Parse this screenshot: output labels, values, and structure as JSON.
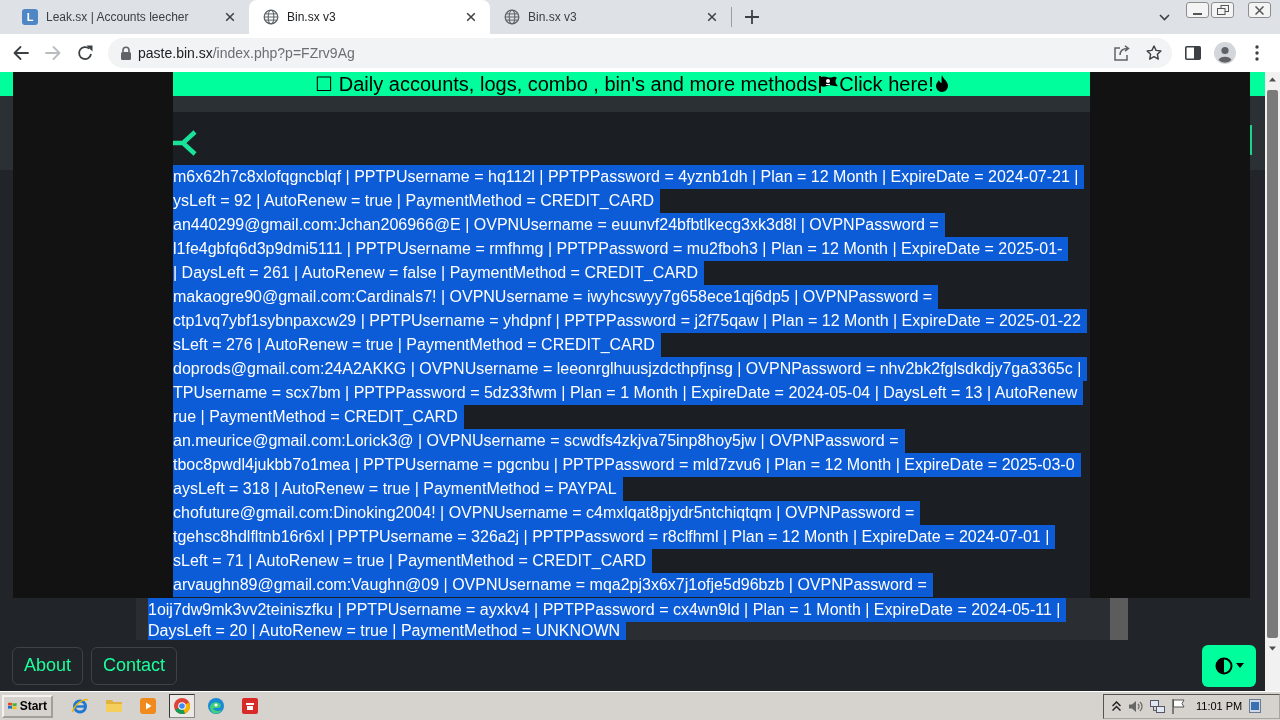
{
  "browser": {
    "tabs": [
      {
        "title": "Leak.sx | Accounts leecher",
        "kind": "letter",
        "favicon_text": "L",
        "selected": false
      },
      {
        "title": "Bin.sx v3",
        "kind": "globe",
        "selected": true
      },
      {
        "title": "Bin.sx v3",
        "kind": "globe",
        "selected": false
      }
    ],
    "nav_buttons": [
      {
        "kind": "back",
        "disabled": false
      },
      {
        "kind": "forward",
        "disabled": true
      },
      {
        "kind": "reload",
        "disabled": false
      }
    ],
    "url": {
      "host": "paste.bin.sx",
      "path": "/index.php?p=FZrv9Ag"
    }
  },
  "banner": {
    "glyph": "☐",
    "text": "Daily accounts, logs, combo , bin's and more methods",
    "link": "Click here!"
  },
  "paste": {
    "selected": true,
    "upper_lines": [
      "m6x62h7c8xlofqgncblqf | PPTPUsername = hq112l | PPTPPassword = 4yznb1dh | Plan = 12 Month | ExpireDate = 2024-07-21 |",
      "ysLeft = 92 | AutoRenew = true | PaymentMethod = CREDIT_CARD",
      "an440299@gmail.com:Jchan206966@E | OVPNUsername = euunvf24bfbtlkecg3xk3d8l | OVPNPassword =",
      "l1fe4gbfq6d3p9dmi5111 | PPTPUsername = rmfhmg | PPTPPassword = mu2fboh3 | Plan = 12 Month | ExpireDate = 2025-01-",
      "| DaysLeft = 261 | AutoRenew = false | PaymentMethod = CREDIT_CARD",
      "makaogre90@gmail.com:Cardinals7! | OVPNUsername = iwyhcswyy7g658ece1qj6dp5 | OVPNPassword =",
      "ctp1vq7ybf1sybnpaxcw29 | PPTPUsername = yhdpnf | PPTPPassword = j2f75qaw | Plan = 12 Month | ExpireDate = 2025-01-22",
      "sLeft = 276 | AutoRenew = true | PaymentMethod = CREDIT_CARD",
      "doprods@gmail.com:24A2AKKG | OVPNUsername = leeonrglhuusjzdcthpfjnsg | OVPNPassword = nhv2bk2fglsdkdjy7ga3365c |",
      "TPUsername = scx7bm | PPTPPassword = 5dz33fwm | Plan = 1 Month | ExpireDate = 2024-05-04 | DaysLeft = 13 | AutoRenew",
      "rue | PaymentMethod = CREDIT_CARD",
      "an.meurice@gmail.com:Lorick3@ | OVPNUsername = scwdfs4zkjva75inp8hoy5jw | OVPNPassword =",
      "tboc8pwdl4jukbb7o1mea | PPTPUsername = pgcnbu | PPTPPassword = mld7zvu6 | Plan = 12 Month | ExpireDate = 2025-03-0",
      "aysLeft = 318 | AutoRenew = true | PaymentMethod = PAYPAL",
      "chofuture@gmail.com:Dinoking2004! | OVPNUsername = c4mxlqat8pjydr5ntchiqtqm | OVPNPassword =",
      "tgehsc8hdlfltnb16r6xl | PPTPUsername = 326a2j | PPTPPassword = r8clfhml | Plan = 12 Month | ExpireDate = 2024-07-01 |",
      "sLeft = 71 | AutoRenew = true | PaymentMethod = CREDIT_CARD",
      "arvaughn89@gmail.com:Vaughn@09 | OVPNUsername = mqa2pj3x6x7j1ofje5d96bzb | OVPNPassword ="
    ],
    "lower_lines": [
      "1oij7dw9mk3vv2teiniszfku | PPTPUsername = ayxkv4 | PPTPPassword = cx4wn9ld | Plan = 1 Month | ExpireDate = 2024-05-11 |",
      "DaysLeft = 20 | AutoRenew = true | PaymentMethod = UNKNOWN"
    ]
  },
  "footer": {
    "links": [
      "About",
      "Contact"
    ]
  },
  "taskbar": {
    "start": "Start",
    "apps": [
      {
        "selected": false
      },
      {
        "selected": false
      },
      {
        "selected": false
      },
      {
        "selected": true
      },
      {
        "selected": false
      },
      {
        "selected": false
      }
    ],
    "clock": "11:01 PM"
  }
}
